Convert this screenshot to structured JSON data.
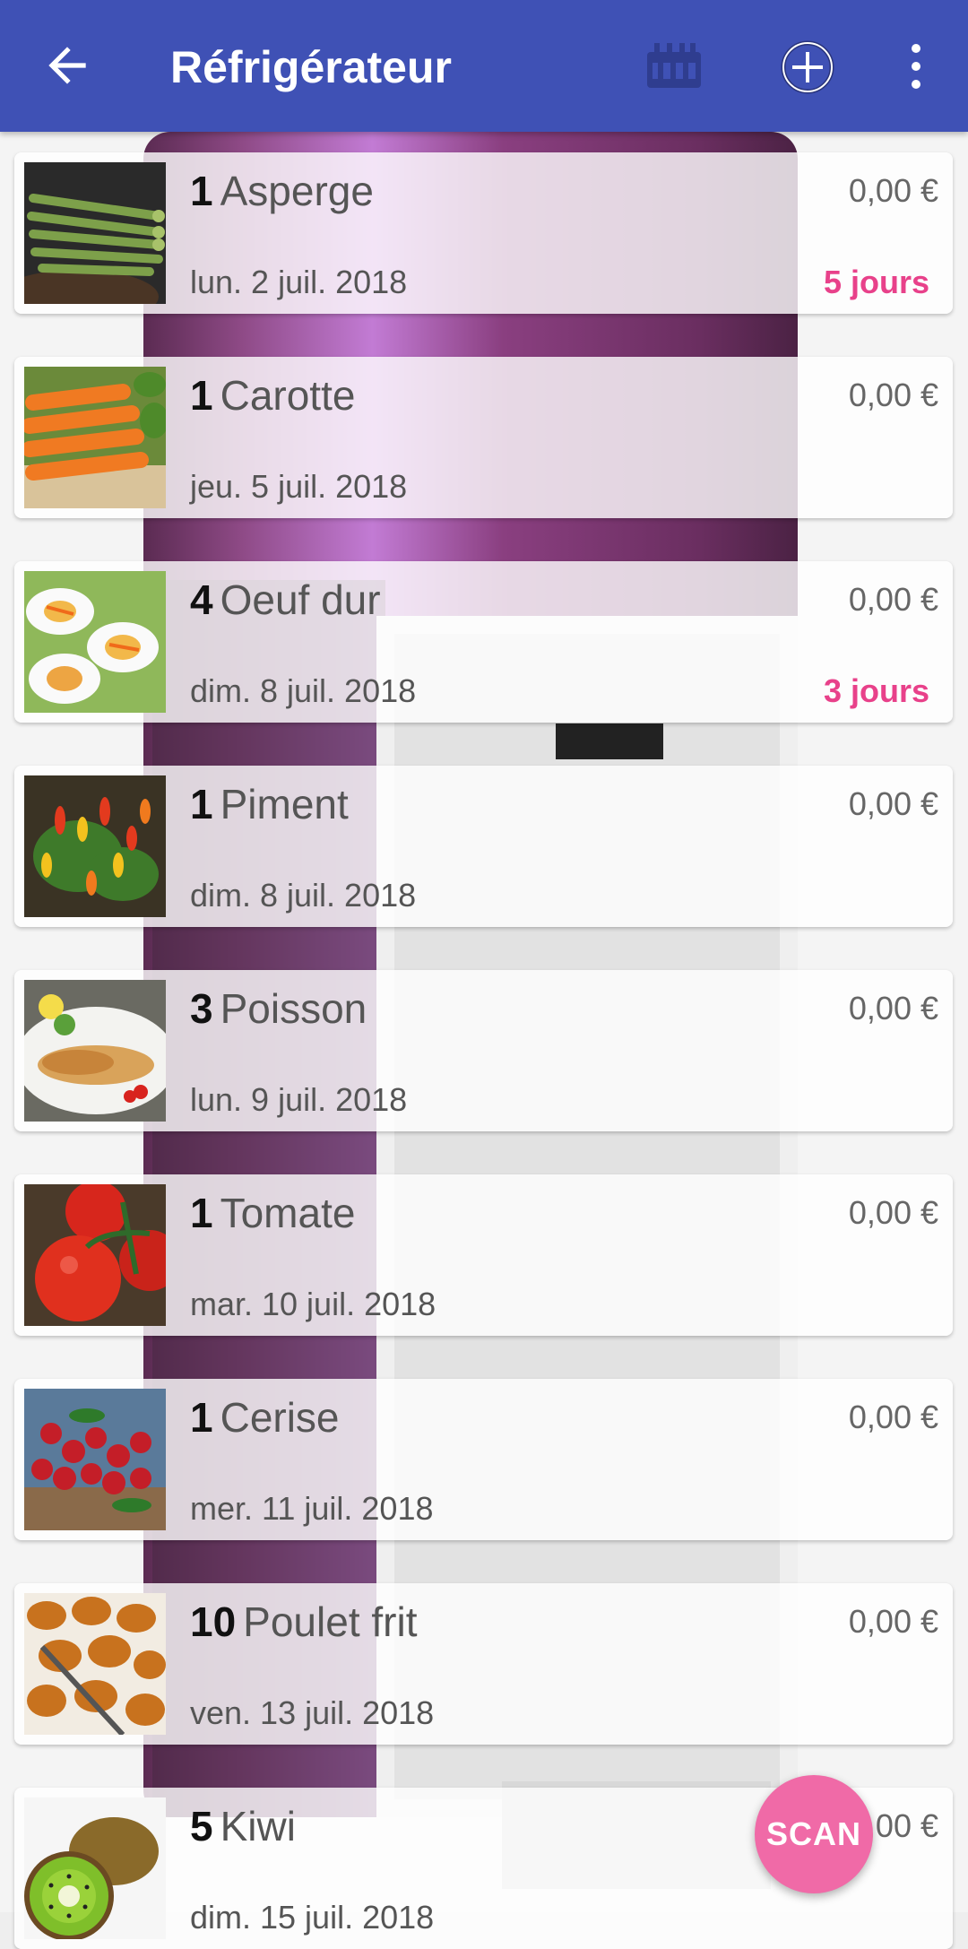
{
  "appbar": {
    "title": "Réfrigérateur",
    "icons": [
      "arrow-back-icon",
      "calendar-icon",
      "add-circle-icon",
      "more-vert-icon"
    ],
    "color": "#3f51b5"
  },
  "items": [
    {
      "qty": "1",
      "name": "Asperge",
      "price": "0,00 €",
      "date": "lun. 2 juil. 2018",
      "days": "5 jours"
    },
    {
      "qty": "1",
      "name": "Carotte",
      "price": "0,00 €",
      "date": "jeu. 5 juil. 2018",
      "days": ""
    },
    {
      "qty": "4",
      "name": "Oeuf dur",
      "price": "0,00 €",
      "date": "dim. 8 juil. 2018",
      "days": "3 jours"
    },
    {
      "qty": "1",
      "name": "Piment",
      "price": "0,00 €",
      "date": "dim. 8 juil. 2018",
      "days": ""
    },
    {
      "qty": "3",
      "name": "Poisson",
      "price": "0,00 €",
      "date": "lun. 9 juil. 2018",
      "days": ""
    },
    {
      "qty": "1",
      "name": "Tomate",
      "price": "0,00 €",
      "date": "mar. 10 juil. 2018",
      "days": ""
    },
    {
      "qty": "1",
      "name": "Cerise",
      "price": "0,00 €",
      "date": "mer. 11 juil. 2018",
      "days": ""
    },
    {
      "qty": "10",
      "name": "Poulet frit",
      "price": "0,00 €",
      "date": "ven. 13 juil. 2018",
      "days": ""
    },
    {
      "qty": "5",
      "name": "Kiwi",
      "price": "0,00 €",
      "date": "dim. 15 juil. 2018",
      "days": ""
    }
  ],
  "fab": {
    "label": "SCAN",
    "color": "#f06aa7"
  },
  "accent_days_color": "#e8418a"
}
